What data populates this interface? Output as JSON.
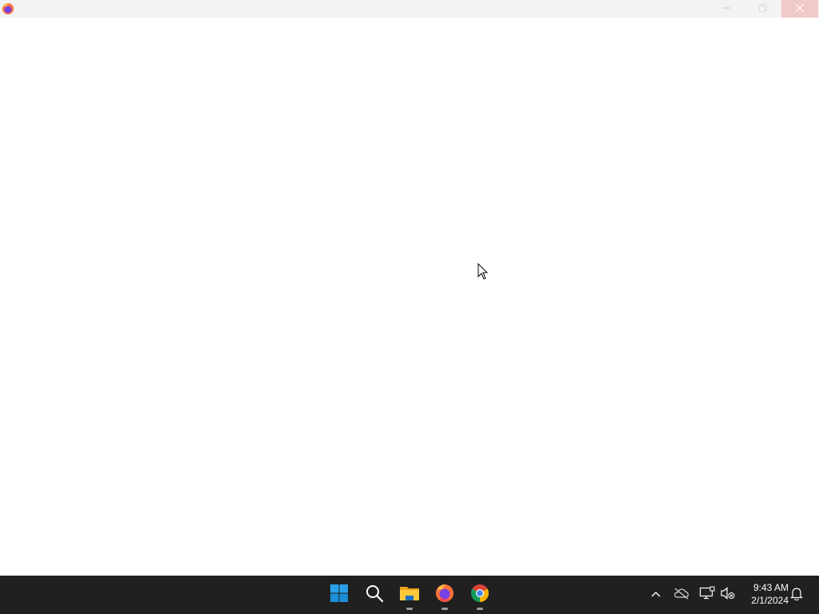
{
  "window": {
    "title": "",
    "app_icon": "firefox-icon",
    "controls": {
      "minimize_icon": "minimize-icon",
      "maximize_icon": "restore-icon",
      "close_icon": "close-icon"
    }
  },
  "taskbar": {
    "pinned": [
      {
        "name": "start",
        "icon": "windows-logo-icon",
        "active": false
      },
      {
        "name": "search",
        "icon": "search-icon",
        "active": false
      },
      {
        "name": "file-explorer",
        "icon": "folder-icon",
        "active": true
      },
      {
        "name": "firefox",
        "icon": "firefox-icon",
        "active": true
      },
      {
        "name": "chrome",
        "icon": "chrome-icon",
        "active": true
      }
    ],
    "tray": {
      "icons": [
        "chevron-up-icon",
        "onedrive-offline-icon",
        "network-icon",
        "volume-muted-icon",
        "notification-bell-icon"
      ],
      "time": "9:43 AM",
      "date": "2/1/2024"
    }
  },
  "colors": {
    "taskbar_bg": "#202020",
    "titlebar_bg": "#f3f3f3",
    "close_hover_bg": "#f0c9c9",
    "windows_blue": "#1f9ce6"
  }
}
